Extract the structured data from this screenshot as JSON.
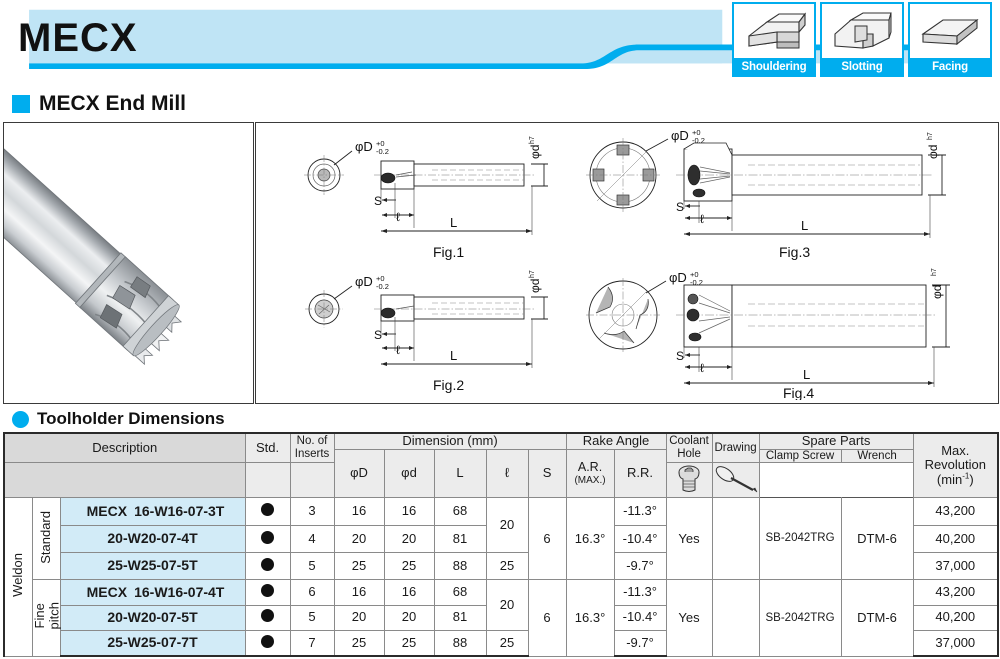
{
  "header": {
    "title": "MECX",
    "band_color": "#bfe4f5",
    "accent_color": "#00adee",
    "app_icons": [
      {
        "label": "Shouldering",
        "icon": "shouldering-block-icon"
      },
      {
        "label": "Slotting",
        "icon": "slotting-block-icon"
      },
      {
        "label": "Facing",
        "icon": "facing-block-icon"
      }
    ]
  },
  "section_product": {
    "title": "MECX End Mill",
    "photo_alt": "mecx-end-mill-photo"
  },
  "figures": [
    {
      "name": "Fig.1",
      "dia_label": "φD",
      "dia_tol_top": "+0",
      "dia_tol_bot": "-0.2",
      "shank_label": "φd",
      "shank_tol": "h7",
      "dims": [
        "S",
        "ℓ",
        "L"
      ]
    },
    {
      "name": "Fig.2",
      "dia_label": "φD",
      "dia_tol_top": "+0",
      "dia_tol_bot": "-0.2",
      "shank_label": "φd",
      "shank_tol": "h7",
      "dims": [
        "S",
        "ℓ",
        "L"
      ]
    },
    {
      "name": "Fig.3",
      "dia_label": "φD",
      "dia_tol_top": "+0",
      "dia_tol_bot": "-0.2",
      "shank_label": "φd",
      "shank_tol": "h7",
      "dims": [
        "S",
        "ℓ",
        "L"
      ]
    },
    {
      "name": "Fig.4",
      "dia_label": "φD",
      "dia_tol_top": "+0",
      "dia_tol_bot": "-0.2",
      "shank_label": "φd",
      "shank_tol": "h7",
      "dims": [
        "S",
        "ℓ",
        "L"
      ]
    }
  ],
  "section_table": {
    "title": "Toolholder Dimensions"
  },
  "table": {
    "headers": {
      "description": "Description",
      "std": "Std.",
      "no_of_inserts_l1": "No. of",
      "no_of_inserts_l2": "Inserts",
      "dimension": "Dimension (mm)",
      "phi_d_cap": "φD",
      "phi_d_small": "φd",
      "L": "L",
      "l": "ℓ",
      "S": "S",
      "rake_angle": "Rake Angle",
      "ar_l1": "A.R.",
      "ar_l2": "(MAX.)",
      "rr": "R.R.",
      "coolant_l1": "Coolant",
      "coolant_l2": "Hole",
      "drawing": "Drawing",
      "spare_parts": "Spare Parts",
      "clamp_screw": "Clamp Screw",
      "wrench": "Wrench",
      "max_rev_l1": "Max.",
      "max_rev_l2": "Revolution",
      "max_rev_l3": "(min",
      "max_rev_sup": "-1",
      "max_rev_l3b": ")"
    },
    "icons": {
      "clamp_screw": "torx-screw-icon",
      "wrench": "screwdriver-wrench-icon",
      "std_marker": "filled-circle-icon"
    },
    "shank_type": "Weldon",
    "groups": [
      {
        "pitch": "Standard",
        "series_prefix": "MECX",
        "rows": [
          {
            "desc": "16-W16-07-3T",
            "std": "●",
            "inserts": "3",
            "phiD": "16",
            "phid": "16",
            "L": "68",
            "l": "20",
            "S": "6",
            "ar": "16.3°",
            "rr": "-11.3°",
            "coolant": "Yes",
            "drawing": "",
            "clamp_screw": "SB-2042TRG",
            "wrench": "DTM-6",
            "max_rev": "43,200"
          },
          {
            "desc": "20-W20-07-4T",
            "std": "●",
            "inserts": "4",
            "phiD": "20",
            "phid": "20",
            "L": "81",
            "l": "20",
            "S": "6",
            "ar": "16.3°",
            "rr": "-10.4°",
            "coolant": "Yes",
            "drawing": "",
            "clamp_screw": "SB-2042TRG",
            "wrench": "DTM-6",
            "max_rev": "40,200"
          },
          {
            "desc": "25-W25-07-5T",
            "std": "●",
            "inserts": "5",
            "phiD": "25",
            "phid": "25",
            "L": "88",
            "l": "25",
            "S": "6",
            "ar": "16.3°",
            "rr": "-9.7°",
            "coolant": "Yes",
            "drawing": "",
            "clamp_screw": "SB-2042TRG",
            "wrench": "DTM-6",
            "max_rev": "37,000"
          }
        ]
      },
      {
        "pitch_l1": "Fine",
        "pitch_l2": "pitch",
        "series_prefix": "MECX",
        "rows": [
          {
            "desc": "16-W16-07-4T",
            "std": "●",
            "inserts": "6",
            "phiD": "16",
            "phid": "16",
            "L": "68",
            "l": "20",
            "S": "6",
            "ar": "16.3°",
            "rr": "-11.3°",
            "coolant": "Yes",
            "drawing": "",
            "clamp_screw": "SB-2042TRG",
            "wrench": "DTM-6",
            "max_rev": "43,200"
          },
          {
            "desc": "20-W20-07-5T",
            "std": "●",
            "inserts": "5",
            "phiD": "20",
            "phid": "20",
            "L": "81",
            "l": "20",
            "S": "6",
            "ar": "16.3°",
            "rr": "-10.4°",
            "coolant": "Yes",
            "drawing": "",
            "clamp_screw": "SB-2042TRG",
            "wrench": "DTM-6",
            "max_rev": "40,200"
          },
          {
            "desc": "25-W25-07-7T",
            "std": "●",
            "inserts": "7",
            "phiD": "25",
            "phid": "25",
            "L": "88",
            "l": "25",
            "S": "6",
            "ar": "16.3°",
            "rr": "-9.7°",
            "coolant": "Yes",
            "drawing": "",
            "clamp_screw": "SB-2042TRG",
            "wrench": "DTM-6",
            "max_rev": "37,000"
          }
        ]
      }
    ]
  }
}
